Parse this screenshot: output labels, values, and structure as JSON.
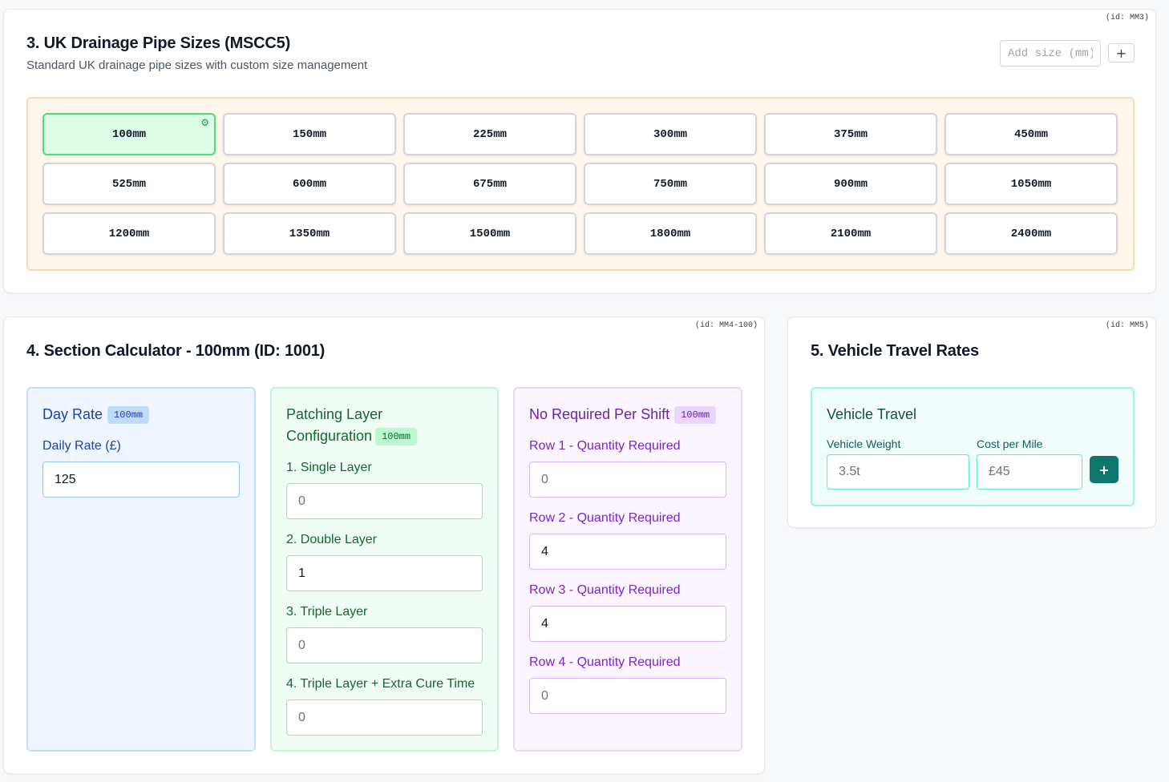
{
  "pipe_sizes_card": {
    "id_label": "(id: MM3)",
    "title": "3. UK Drainage Pipe Sizes (MSCC5)",
    "subtitle": "Standard UK drainage pipe sizes with custom size management",
    "add_size_placeholder": "Add size (mm)",
    "add_size_button": "+",
    "selected_size": "100mm",
    "sizes": [
      "100mm",
      "150mm",
      "225mm",
      "300mm",
      "375mm",
      "450mm",
      "525mm",
      "600mm",
      "675mm",
      "750mm",
      "900mm",
      "1050mm",
      "1200mm",
      "1350mm",
      "1500mm",
      "1800mm",
      "2100mm",
      "2400mm"
    ],
    "selected_icon": "gear-icon"
  },
  "section_calculator": {
    "id_label": "(id: MM4-100)",
    "title": "4. Section Calculator - 100mm (ID: 1001)",
    "day_rate": {
      "title": "Day Rate",
      "badge": "100mm",
      "label": "Daily Rate (£)",
      "value": "125"
    },
    "patching": {
      "title": "Patching Layer Configuration",
      "badge": "100mm",
      "fields": [
        {
          "label": "1. Single Layer",
          "value": "",
          "placeholder": "0"
        },
        {
          "label": "2. Double Layer",
          "value": "1",
          "placeholder": "0"
        },
        {
          "label": "3. Triple Layer",
          "value": "",
          "placeholder": "0"
        },
        {
          "label": "4. Triple Layer + Extra Cure Time",
          "value": "",
          "placeholder": "0"
        }
      ]
    },
    "per_shift": {
      "title": "No Required Per Shift",
      "badge": "100mm",
      "fields": [
        {
          "label": "Row 1 - Quantity Required",
          "value": "",
          "placeholder": "0"
        },
        {
          "label": "Row 2 - Quantity Required",
          "value": "4",
          "placeholder": "0"
        },
        {
          "label": "Row 3 - Quantity Required",
          "value": "4",
          "placeholder": "0"
        },
        {
          "label": "Row 4 - Quantity Required",
          "value": "",
          "placeholder": "0"
        }
      ]
    }
  },
  "vehicle_travel": {
    "id_label": "(id: MM5)",
    "title": "5. Vehicle Travel Rates",
    "panel_title": "Vehicle Travel",
    "weight_label": "Vehicle Weight",
    "weight_placeholder": "3.5t",
    "cost_label": "Cost per Mile",
    "cost_placeholder": "£45",
    "add_button": "+"
  },
  "colors": {
    "selected_pipe_bg": "#dcfce7",
    "selected_pipe_border": "#4ade80",
    "pipe_grid_bg": "#fff7ed",
    "day_rate_accent": "#1e40af",
    "patching_accent": "#166534",
    "per_shift_accent": "#7e22ce",
    "vehicle_accent": "#0f766e"
  }
}
